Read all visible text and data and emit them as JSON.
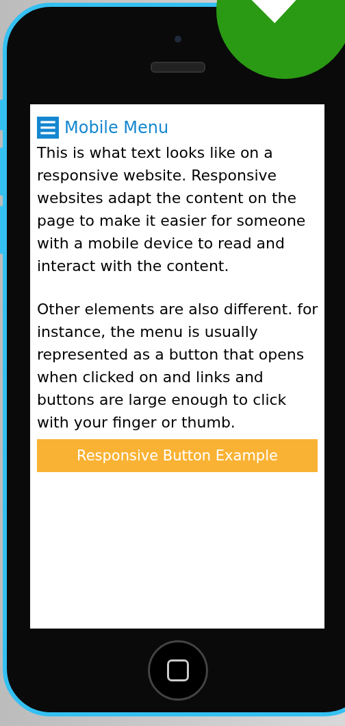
{
  "menu": {
    "title": "Mobile Menu"
  },
  "paragraphs": [
    "This is what text looks like on a responsive website. Responsive websites adapt the content on the page to make it easier for someone with a mobile device to read and interact with the content.",
    "Other elements are also different. for instance, the menu is usually represented as a button that opens when clicked on and links and buttons are large enough to click with your finger or thumb."
  ],
  "button": {
    "label": "Responsive Button Example"
  }
}
